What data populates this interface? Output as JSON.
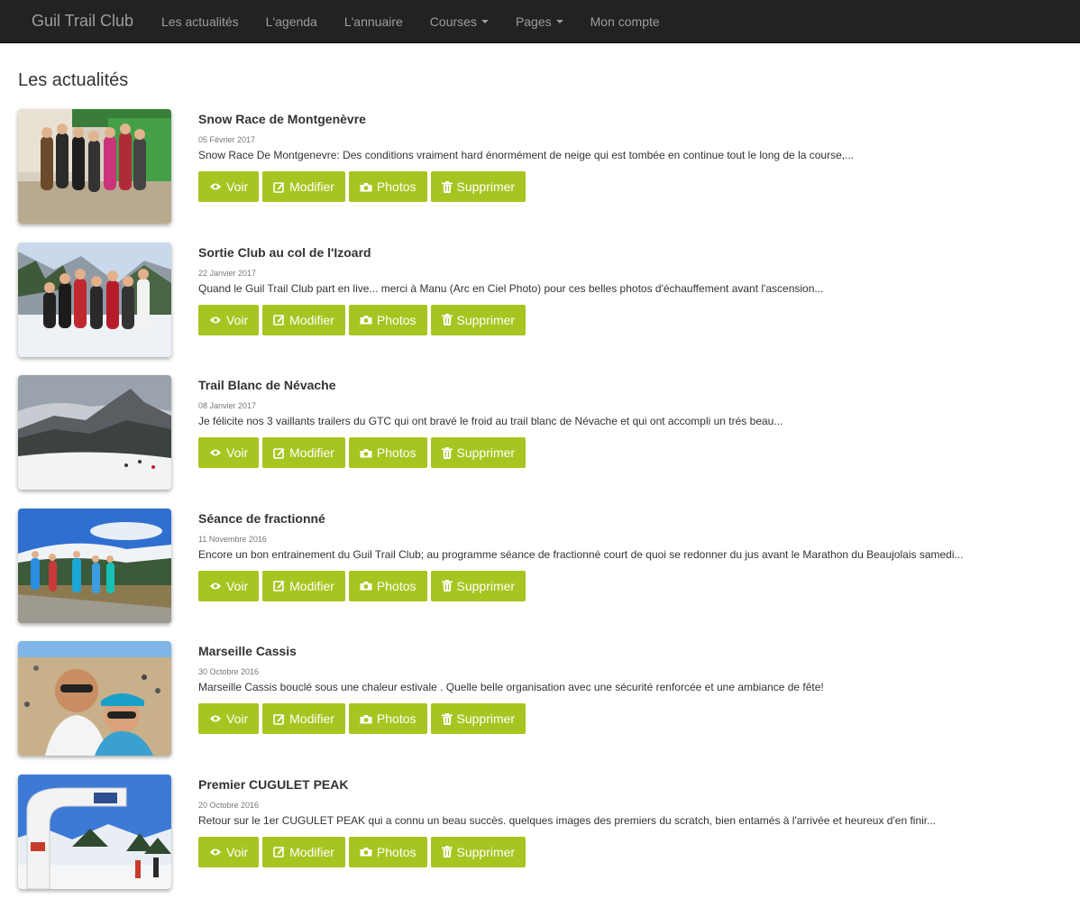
{
  "navbar": {
    "brand": "Guil Trail Club",
    "items": [
      {
        "label": "Les actualités"
      },
      {
        "label": "L'agenda"
      },
      {
        "label": "L'annuaire"
      },
      {
        "label": "Courses"
      },
      {
        "label": "Pages"
      },
      {
        "label": "Mon compte"
      }
    ]
  },
  "page": {
    "title": "Les actualités"
  },
  "actions": {
    "view_label": "Voir",
    "edit_label": "Modifier",
    "photos_label": "Photos",
    "delete_label": "Supprimer"
  },
  "news": [
    {
      "title": "Snow Race de Montgenèvre",
      "date": "05 Février 2017",
      "excerpt": "Snow Race De Montgenevre: Des conditions vraiment hard énormément de neige qui est tombée en continue tout le long de la course,..."
    },
    {
      "title": "Sortie Club au col de l'Izoard",
      "date": "22 Janvier 2017",
      "excerpt": "Quand le Guil Trail Club part en live... merci à Manu (Arc en Ciel Photo) pour ces belles photos d'échauffement avant l'ascension..."
    },
    {
      "title": "Trail Blanc de Névache",
      "date": "08 Janvier 2017",
      "excerpt": "Je félicite nos 3 vaillants trailers du GTC qui ont bravé le froid au trail blanc de Névache et qui ont accompli un trés beau..."
    },
    {
      "title": "Séance de fractionné",
      "date": "11 Novembre 2016",
      "excerpt": "Encore un bon entrainement du Guil Trail Club; au programme séance de fractionné court de quoi se redonner du jus avant le Marathon du Beaujolais samedi..."
    },
    {
      "title": "Marseille Cassis",
      "date": "30 Octobre 2016",
      "excerpt": "Marseille Cassis bouclé sous une chaleur estivale . Quelle belle organisation avec une sécurité renforcée et une ambiance de fête!"
    },
    {
      "title": "Premier CUGULET PEAK",
      "date": "20 Octobre 2016",
      "excerpt": "Retour sur le 1er CUGULET PEAK qui a connu un beau succès. quelques images des premiers du scratch, bien entamés à l'arrivée et heureux d'en finir..."
    }
  ]
}
